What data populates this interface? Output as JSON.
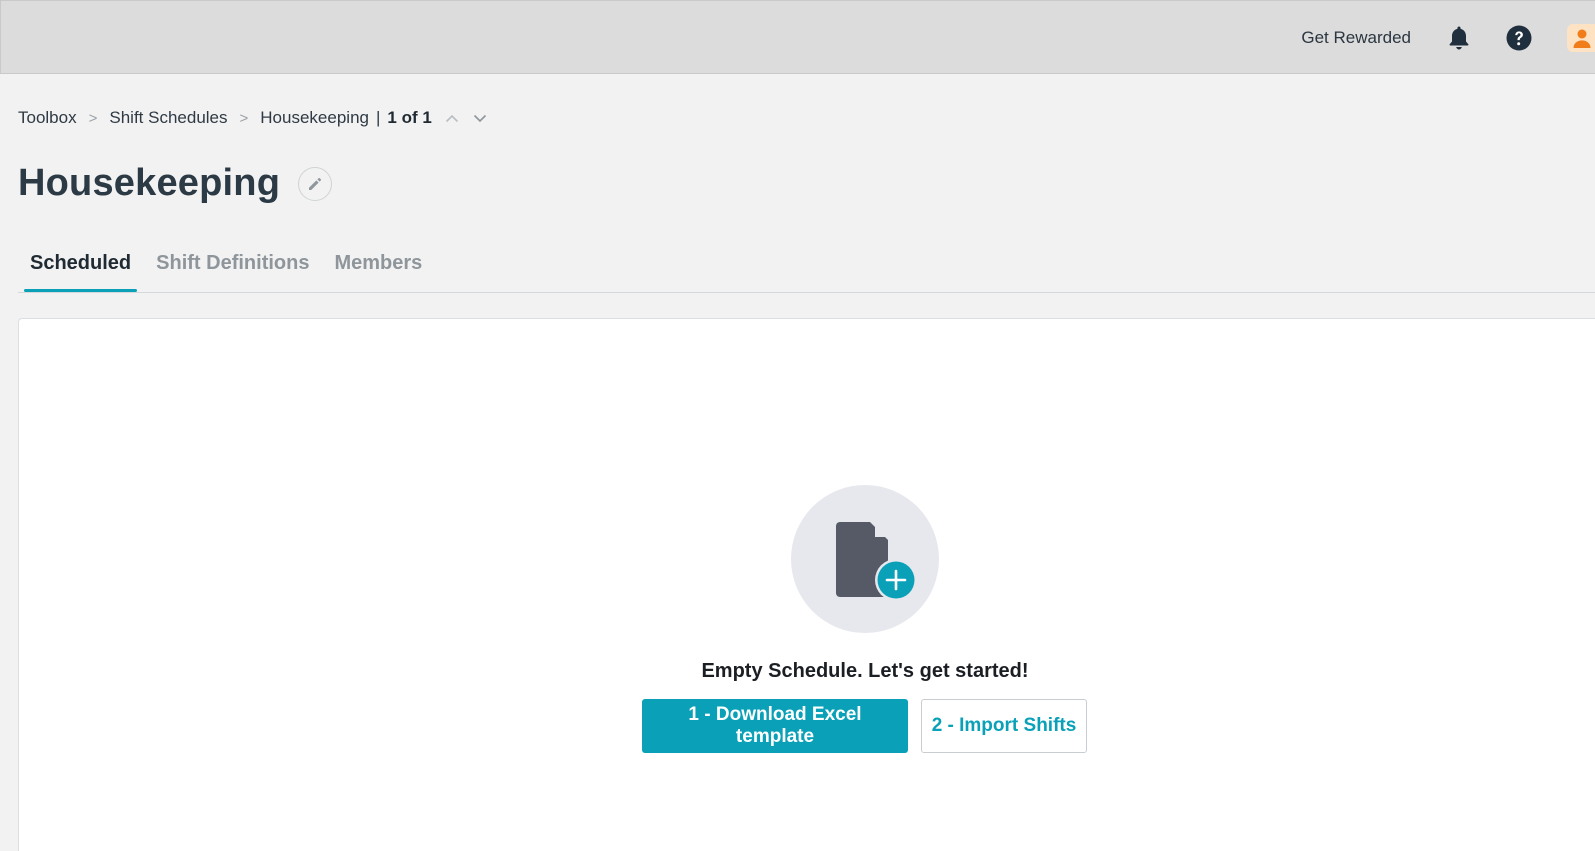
{
  "header": {
    "get_rewarded": "Get Rewarded",
    "icons": {
      "notifications": "bell-icon",
      "help": "help-icon",
      "profile": "user-avatar-icon"
    },
    "colors": {
      "accent": "#0aa1b8",
      "avatar": "#f07d1a"
    }
  },
  "breadcrumb": {
    "items": [
      "Toolbox",
      "Shift Schedules",
      "Housekeeping"
    ],
    "separator": ">",
    "pipe": "|",
    "count": "1 of 1"
  },
  "page": {
    "title": "Housekeeping"
  },
  "tabs": [
    {
      "label": "Scheduled",
      "active": true
    },
    {
      "label": "Shift Definitions",
      "active": false
    },
    {
      "label": "Members",
      "active": false
    }
  ],
  "empty_state": {
    "icon": "file-add-icon",
    "message": "Empty Schedule. Let's get started!",
    "primary_button": "1 - Download Excel template",
    "secondary_button": "2 - Import Shifts"
  }
}
